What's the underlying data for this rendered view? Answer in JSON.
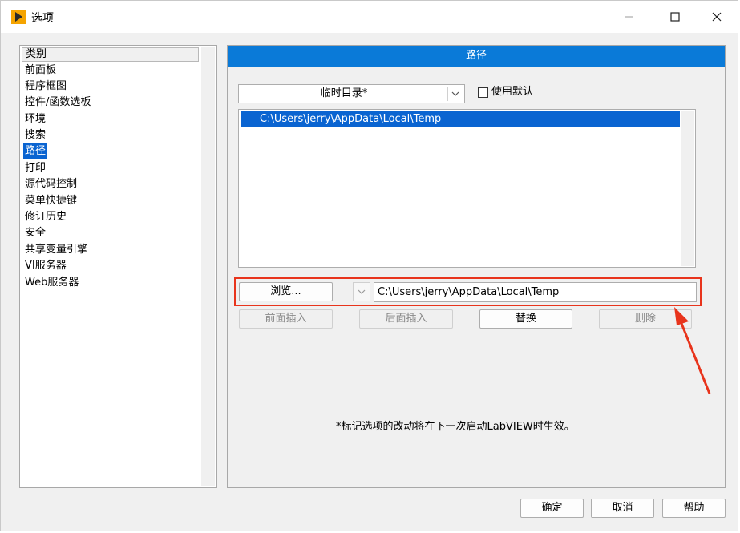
{
  "window": {
    "title": "选项"
  },
  "categories": {
    "header": "类别",
    "items": [
      {
        "label": "前面板"
      },
      {
        "label": "程序框图"
      },
      {
        "label": "控件/函数选板"
      },
      {
        "label": "环境"
      },
      {
        "label": "搜索"
      },
      {
        "label": "路径",
        "selected": true
      },
      {
        "label": "打印"
      },
      {
        "label": "源代码控制"
      },
      {
        "label": "菜单快捷键"
      },
      {
        "label": "修订历史"
      },
      {
        "label": "安全"
      },
      {
        "label": "共享变量引擎"
      },
      {
        "label": "VI服务器"
      },
      {
        "label": "Web服务器"
      }
    ]
  },
  "panel": {
    "title": "路径",
    "dropdown_value": "临时目录*",
    "use_default_label": "使用默认",
    "use_default_checked": false,
    "path_list": [
      "C:\\Users\\jerry\\AppData\\Local\\Temp"
    ],
    "browse_label": "浏览...",
    "path_value": "C:\\Users\\jerry\\AppData\\Local\\Temp",
    "insert_before_label": "前面插入",
    "insert_after_label": "后面插入",
    "replace_label": "替换",
    "delete_label": "删除",
    "note": "*标记选项的改动将在下一次启动LabVIEW时生效。"
  },
  "footer": {
    "ok_label": "确定",
    "cancel_label": "取消",
    "help_label": "帮助"
  },
  "colors": {
    "accent": "#0a7ad8",
    "selection": "#0a64d1",
    "highlight": "#e8341c"
  }
}
